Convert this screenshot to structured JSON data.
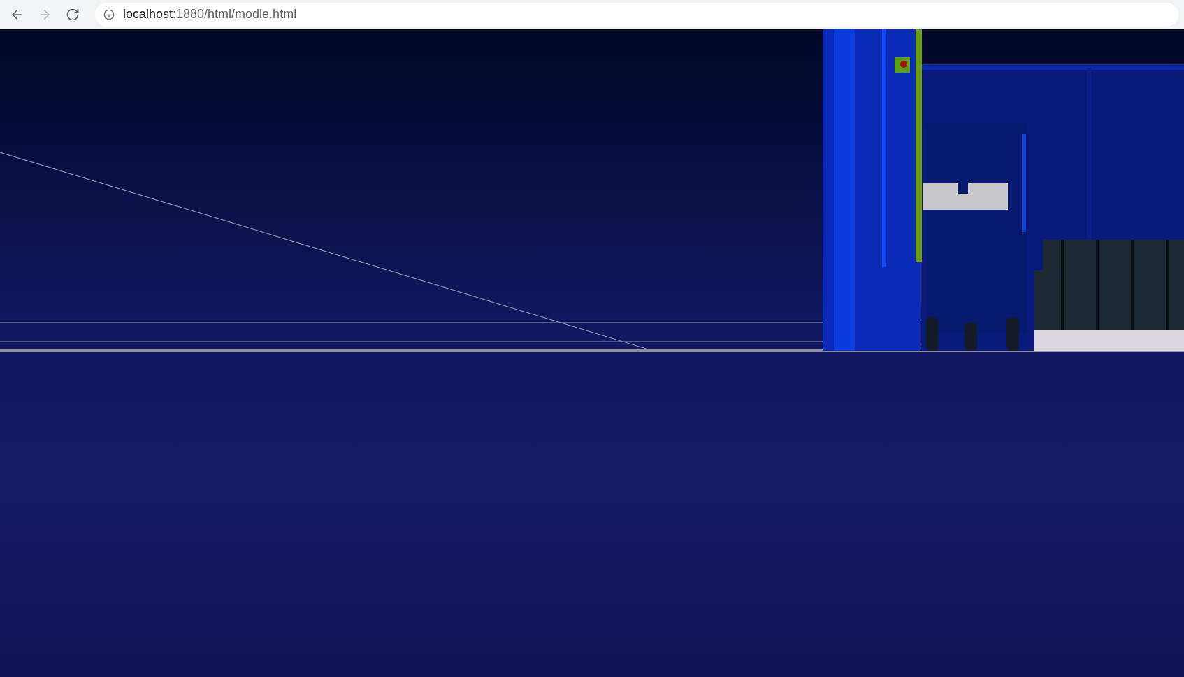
{
  "toolbar": {
    "nav_buttons": [
      {
        "kind": "back",
        "disabled": false
      },
      {
        "kind": "forward",
        "disabled": true
      },
      {
        "kind": "reload",
        "disabled": false
      }
    ],
    "address": {
      "host": "localhost",
      "rest": ":1880/html/modle.html"
    }
  }
}
